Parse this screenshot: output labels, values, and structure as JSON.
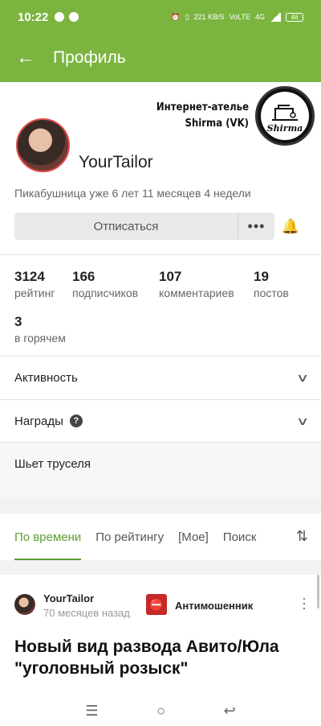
{
  "status": {
    "time": "10:22",
    "speed": "221 KB/S",
    "net": "VoLTE",
    "lte": "4G",
    "battery": "46"
  },
  "appbar": {
    "title": "Профиль",
    "back_icon": "arrow-left-icon"
  },
  "promo": {
    "line1": "Интернет-ателье",
    "line2": "Shirma (VK)",
    "logo_text": "Shirma"
  },
  "profile": {
    "username": "YourTailor",
    "tenure": "Пикабушница уже 6 лет 11 месяцев 4 недели",
    "unsubscribe_label": "Отписаться",
    "more_label": "•••"
  },
  "stats": [
    {
      "value": "3124",
      "label": "рейтинг"
    },
    {
      "value": "166",
      "label": "подписчиков"
    },
    {
      "value": "107",
      "label": "комментариев"
    },
    {
      "value": "19",
      "label": "постов"
    },
    {
      "value": "3",
      "label": "в горячем"
    }
  ],
  "sections": {
    "activity": "Активность",
    "awards": "Награды"
  },
  "bio": "Шьет труселя",
  "tabs": [
    "По времени",
    "По рейтингу",
    "[Мое]",
    "Поиск"
  ],
  "post": {
    "author": "YourTailor",
    "time": "70 месяцев назад",
    "community": "Антимошенник",
    "title": "Новый вид развода Авито/Юла \"уголовный розыск\""
  },
  "nav": {
    "menu": "☰",
    "home": "○",
    "back": "↩"
  }
}
